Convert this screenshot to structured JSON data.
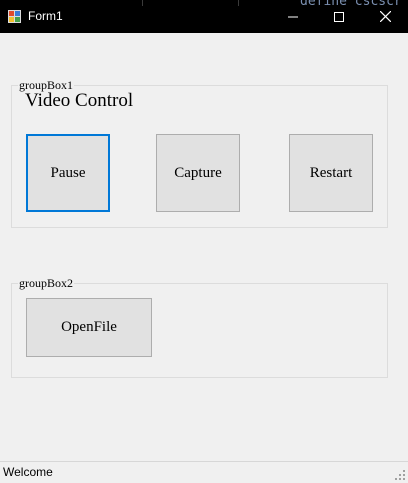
{
  "window": {
    "title": "Form1",
    "background_code_snippet": "define  cscscr",
    "controls": {
      "minimize_icon": "minimize-icon",
      "maximize_icon": "maximize-icon",
      "close_icon": "close-icon"
    }
  },
  "group1": {
    "legend": "groupBox1",
    "heading": "Video Control",
    "buttons": {
      "pause": "Pause",
      "capture": "Capture",
      "restart": "Restart"
    }
  },
  "group2": {
    "legend": "groupBox2",
    "buttons": {
      "openfile": "OpenFile"
    }
  },
  "statusbar": {
    "text": "Welcome"
  },
  "colors": {
    "titlebar": "#000000",
    "focus_border": "#0078d7",
    "button_face": "#e1e1e1",
    "form_background": "#f0f0f0"
  }
}
